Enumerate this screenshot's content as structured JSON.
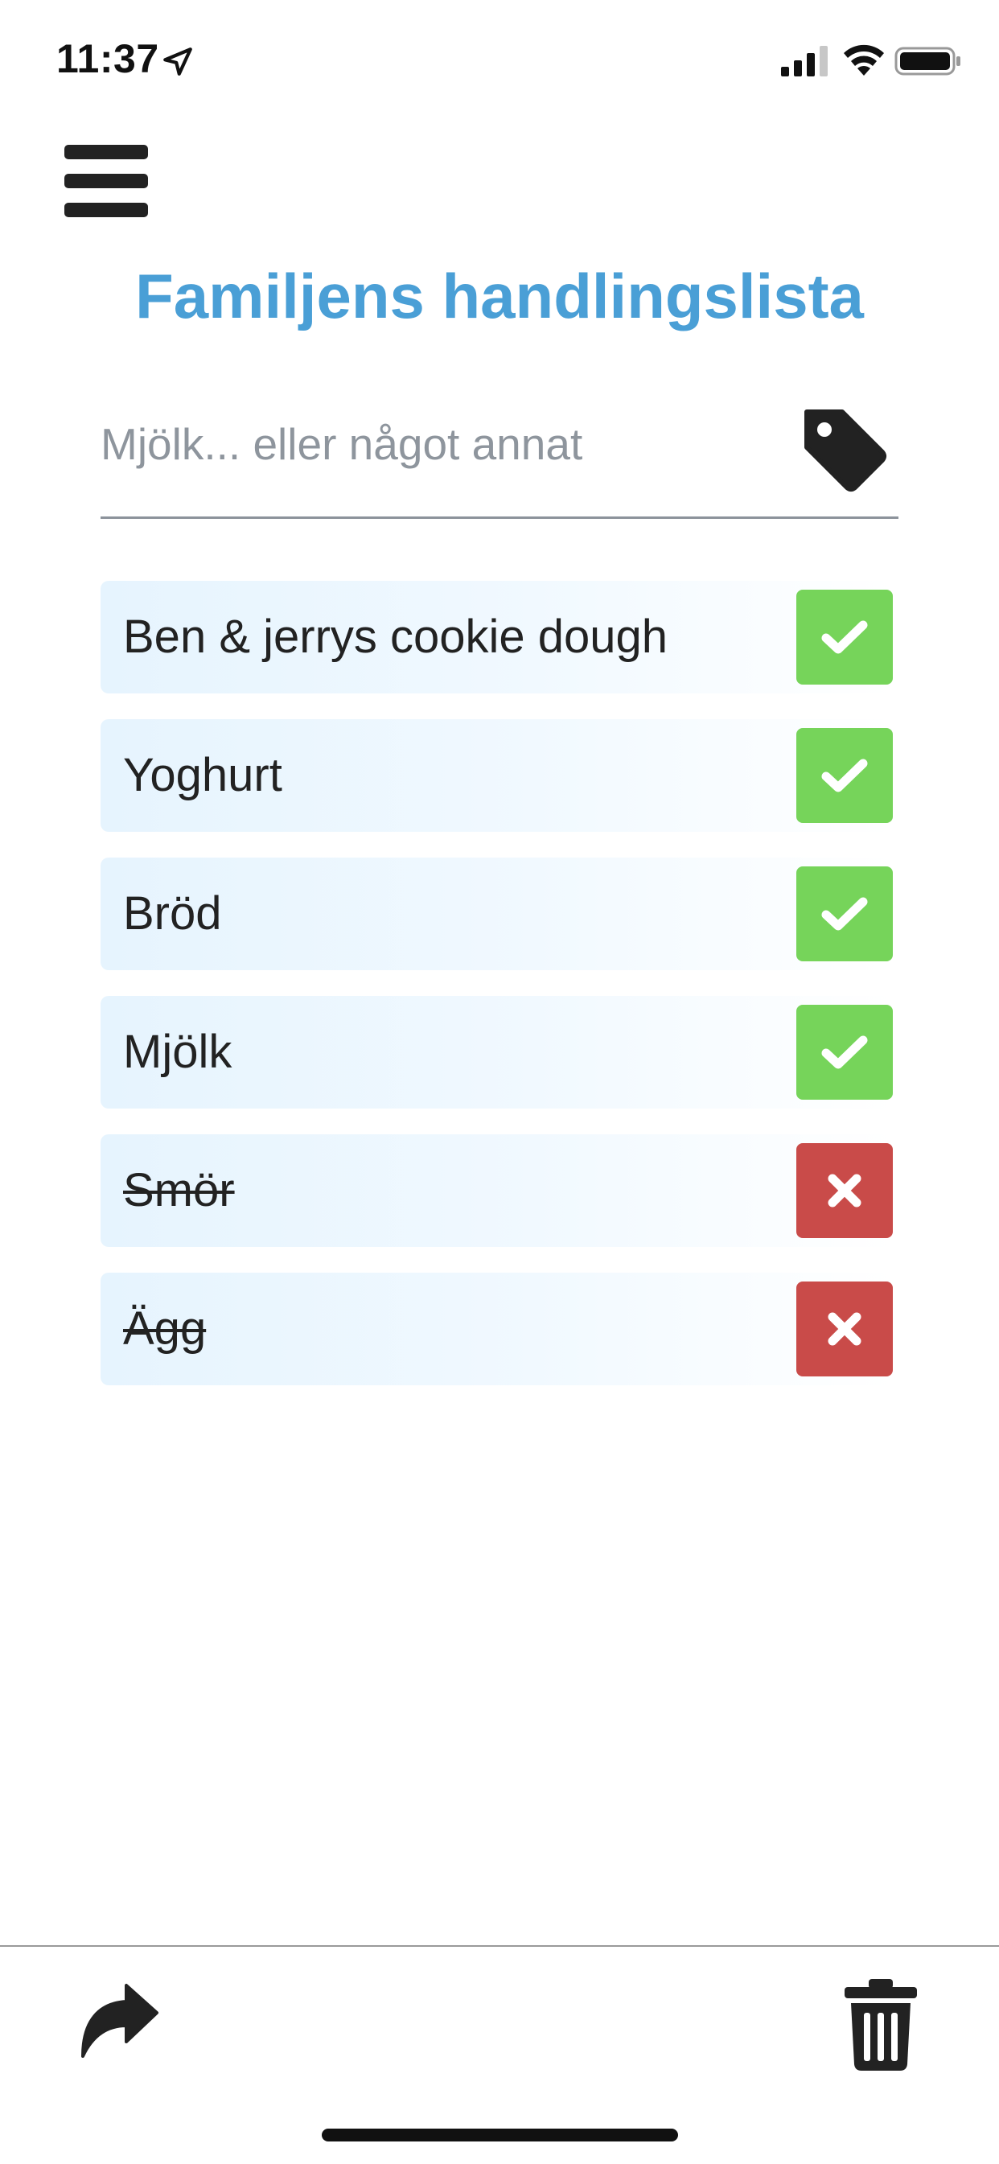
{
  "status_bar": {
    "time": "11:37",
    "icons": [
      "location-arrow-icon",
      "cellular-signal-icon",
      "wifi-icon",
      "battery-icon"
    ]
  },
  "header": {
    "menu_icon": "hamburger-menu-icon",
    "title": "Familjens handlingslista"
  },
  "input": {
    "placeholder": "Mjölk... eller något annat",
    "value": "",
    "tag_icon": "tag-icon"
  },
  "items": [
    {
      "label": "Ben & jerrys cookie dough",
      "done": false,
      "action_icon": "check-icon"
    },
    {
      "label": "Yoghurt",
      "done": false,
      "action_icon": "check-icon"
    },
    {
      "label": "Bröd",
      "done": false,
      "action_icon": "check-icon"
    },
    {
      "label": "Mjölk",
      "done": false,
      "action_icon": "check-icon"
    },
    {
      "label": "Smör",
      "done": true,
      "action_icon": "close-icon"
    },
    {
      "label": "Ägg",
      "done": true,
      "action_icon": "close-icon"
    }
  ],
  "bottom_bar": {
    "share_icon": "share-arrow-icon",
    "trash_icon": "trash-icon"
  },
  "colors": {
    "title": "#4a9fd6",
    "check_button": "#76d45a",
    "remove_button": "#c94b49",
    "row_background": "#e6f4fe",
    "icon_dark": "#222222"
  }
}
